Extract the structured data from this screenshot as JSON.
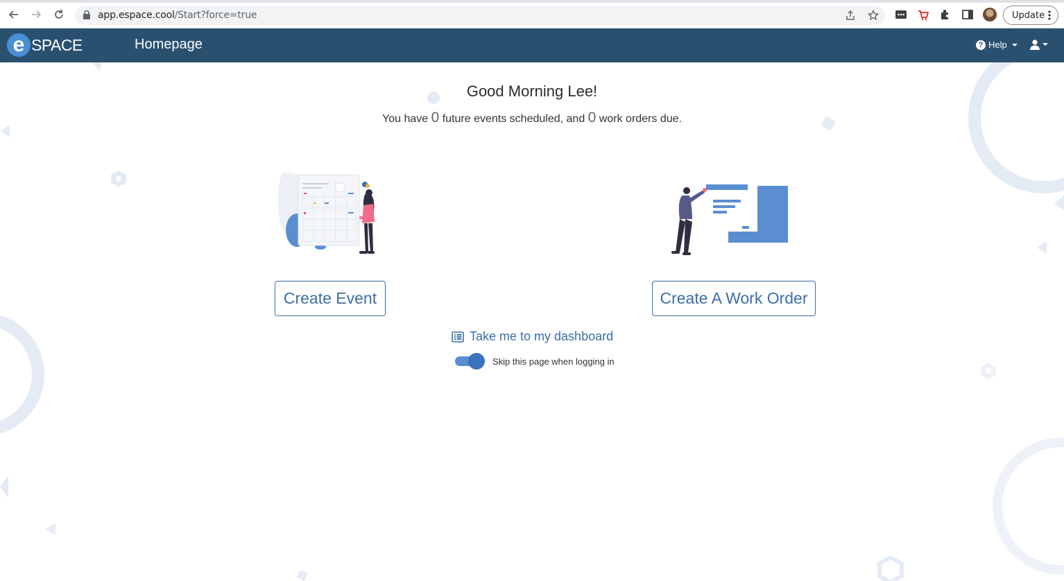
{
  "browser": {
    "url_host": "app.espace.cool",
    "url_path": "/Start?force=true",
    "update_label": "Update"
  },
  "header": {
    "logo_letter": "e",
    "logo_word": "SPACE",
    "title": "Homepage",
    "help_label": "Help"
  },
  "main": {
    "greeting": "Good Morning Lee!",
    "summary_prefix": "You have",
    "events_count": "0",
    "summary_middle": "future events scheduled, and",
    "work_orders_count": "0",
    "summary_suffix": "work orders due.",
    "create_event_label": "Create Event",
    "create_work_order_label": "Create A Work Order",
    "dashboard_link_label": "Take me to my dashboard",
    "skip_toggle_label": "Skip this page when logging in",
    "skip_toggle_on": true
  },
  "colors": {
    "header_bg": "#2a5070",
    "accent": "#3b6ea5",
    "decoration": "#e4ebf4"
  }
}
